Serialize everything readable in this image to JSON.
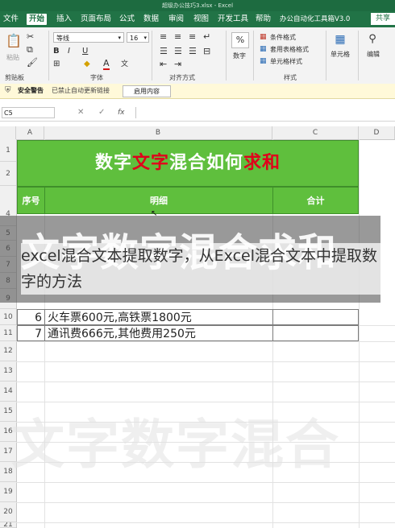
{
  "window": {
    "title": "超级办公技巧3.xlsx - Excel"
  },
  "menu": {
    "items": [
      "文件",
      "开始",
      "插入",
      "页面布局",
      "公式",
      "数据",
      "审阅",
      "视图",
      "开发工具",
      "帮助",
      "办公自动化工具箱V3.0"
    ],
    "share_label": "共享"
  },
  "ribbon": {
    "clipboard": {
      "paste_label": "粘贴",
      "group_label": "剪贴板"
    },
    "font": {
      "font_name": "等线",
      "font_size": "16",
      "group_label": "字体",
      "bold": "B",
      "italic": "I",
      "underline": "U"
    },
    "alignment": {
      "group_label": "对齐方式"
    },
    "number": {
      "label": "数字",
      "symbol": "%"
    },
    "styles": {
      "conditional": "条件格式",
      "table_format": "套用表格格式",
      "cell_style": "单元格样式",
      "group_label": "样式"
    },
    "cells": {
      "label": "单元格"
    },
    "editing": {
      "label": "编辑"
    }
  },
  "security_bar": {
    "title": "安全警告",
    "message": "已禁止自动更新链接",
    "button_label": "启用内容"
  },
  "formula_bar": {
    "name_box": "C5",
    "cancel": "✕",
    "confirm": "✓",
    "fx": "fx"
  },
  "columns": [
    "A",
    "B",
    "C",
    "D"
  ],
  "rows": [
    "1",
    "2",
    "4",
    "5",
    "6",
    "7",
    "8",
    "9",
    "10",
    "11",
    "12",
    "13",
    "14",
    "15",
    "16",
    "17",
    "18",
    "19",
    "20",
    "21"
  ],
  "sheet": {
    "title_parts": [
      {
        "text": "数字",
        "color": "#ffffff"
      },
      {
        "text": "文字",
        "color": "#e0001b"
      },
      {
        "text": "混合如何",
        "color": "#ffffff"
      },
      {
        "text": "求和",
        "color": "#e0001b"
      }
    ],
    "headers": {
      "seq": "序号",
      "detail": "明细",
      "total": "合计"
    },
    "rows": [
      {
        "seq": "6",
        "detail": "火车票600元,高铁票1800元"
      },
      {
        "seq": "7",
        "detail": "通讯费666元,其他费用250元"
      }
    ]
  },
  "caption": {
    "big_text": "文字数字混合求和",
    "subtitle": "excel混合文本提取数字，从Excel混合文本中提取数字的方法"
  },
  "watermark": "文字数字混合"
}
